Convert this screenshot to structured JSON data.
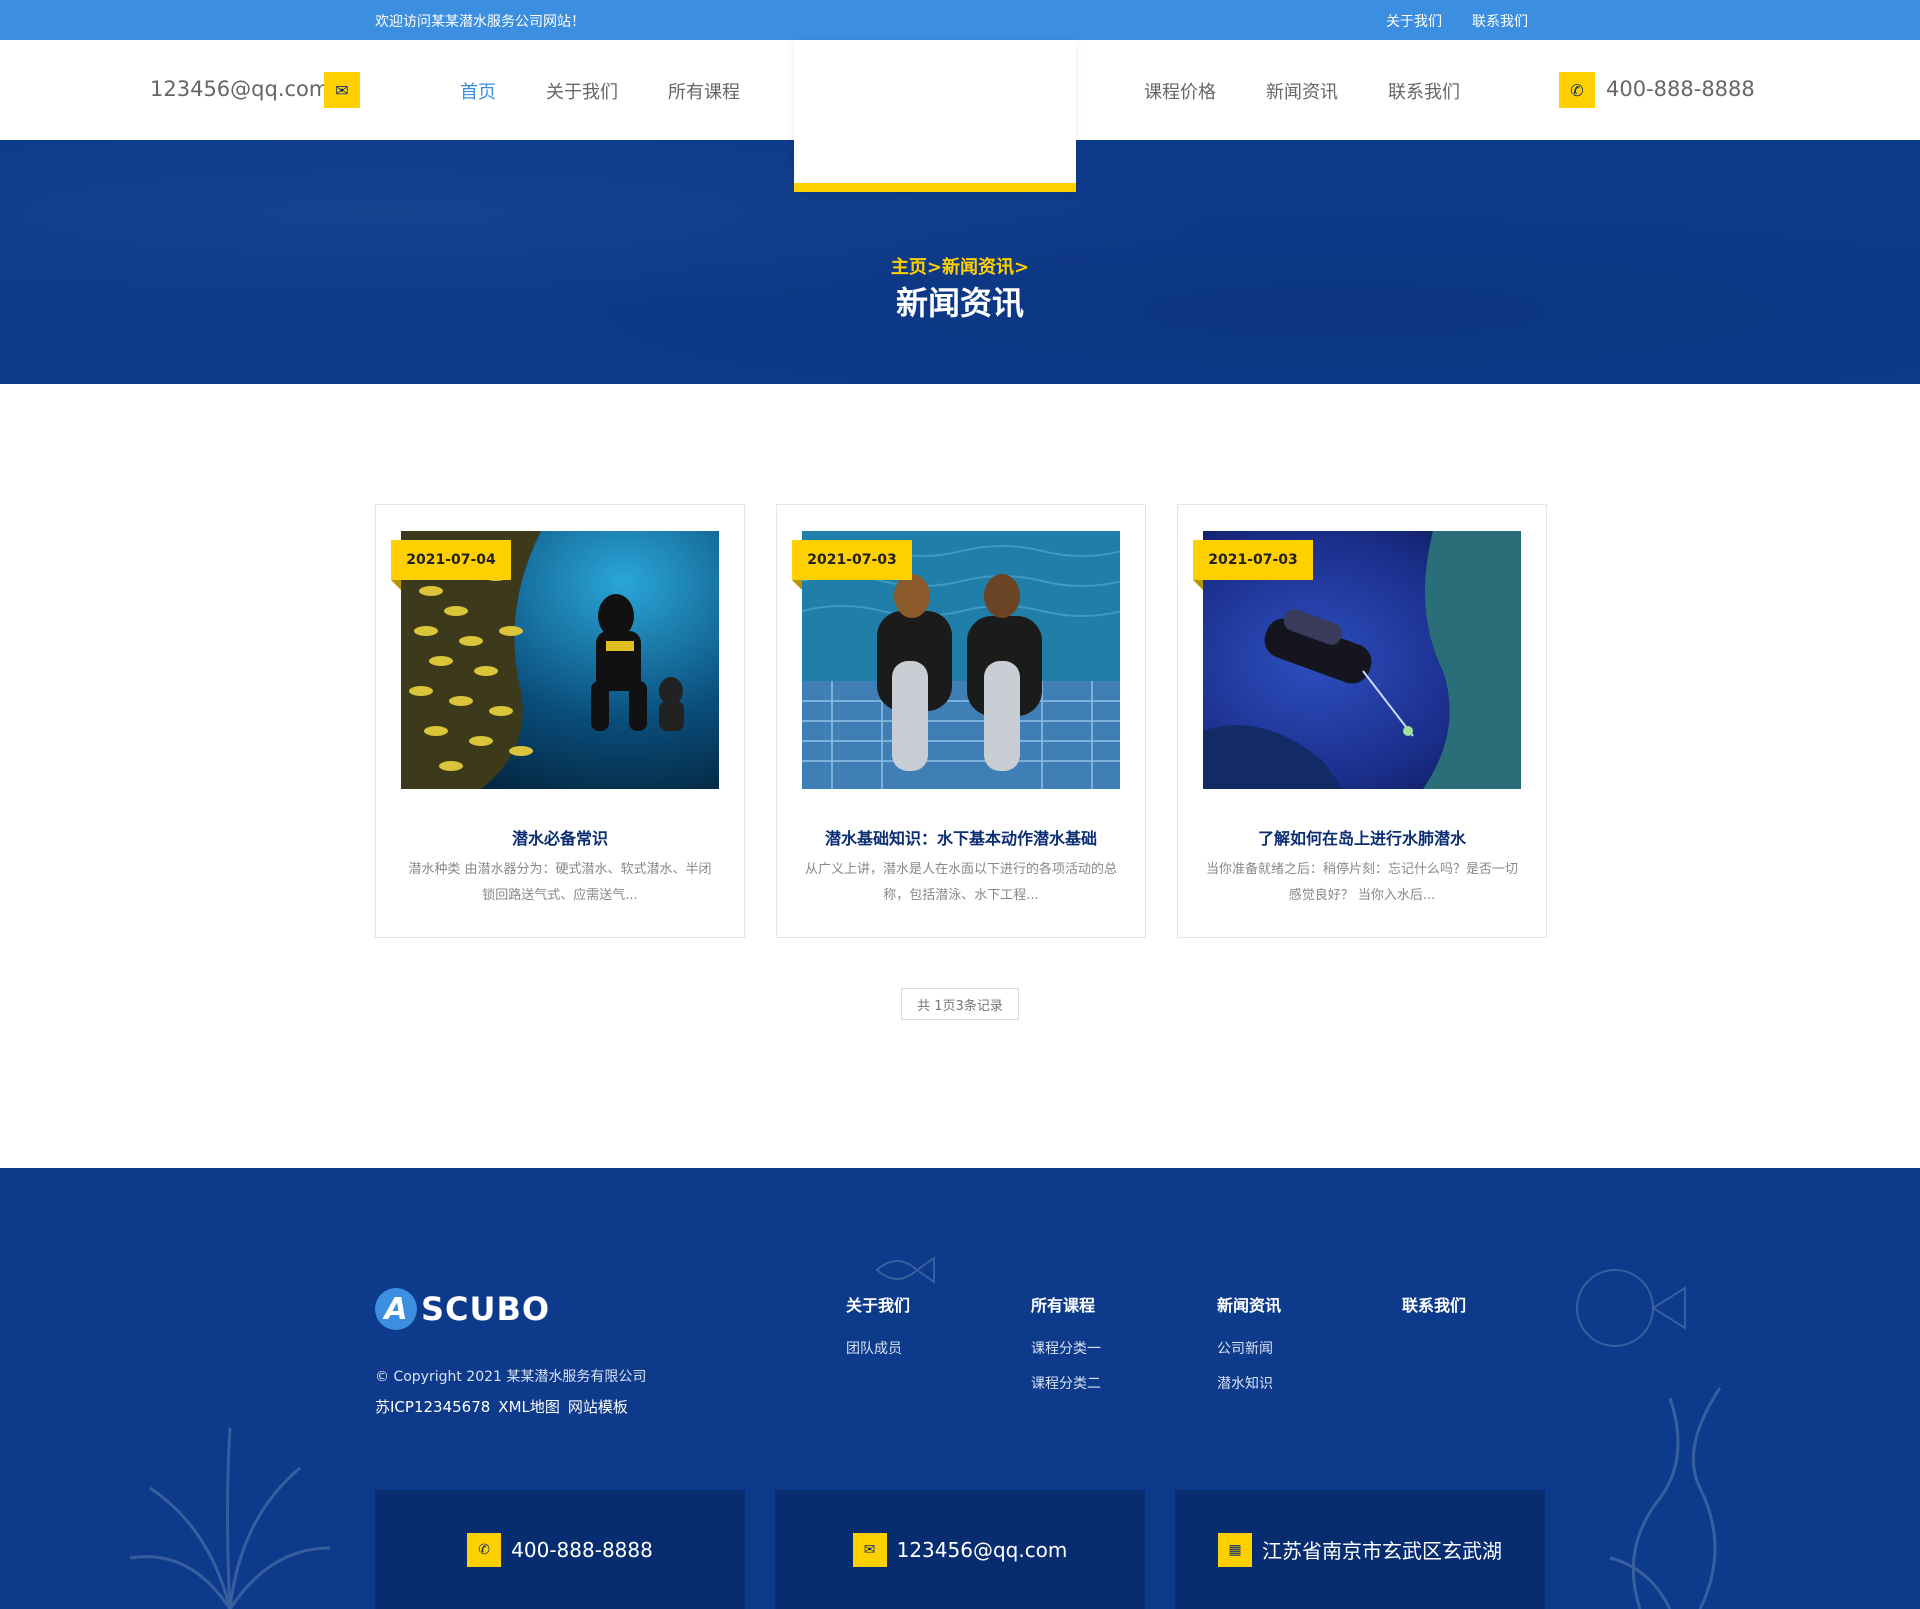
{
  "topbar": {
    "welcome": "欢迎访问某某潜水服务公司网站！",
    "links": [
      "关于我们",
      "联系我们"
    ]
  },
  "header": {
    "email": "123456@qq.com",
    "phone": "400-888-8888",
    "nav_left": [
      "首页",
      "关于我们",
      "所有课程"
    ],
    "nav_right": [
      "课程价格",
      "新闻资讯",
      "联系我们"
    ],
    "active": "首页"
  },
  "banner": {
    "breadcrumb": "主页>新闻资讯>",
    "title": "新闻资讯"
  },
  "news": [
    {
      "date": "2021-07-04",
      "title": "潜水必备常识",
      "desc": "潜水种类 由潜水器分为：硬式潜水、软式潜水、半闭锁回路送气式、应需送气..."
    },
    {
      "date": "2021-07-03",
      "title": "潜水基础知识：水下基本动作潜水基础",
      "desc": "从广义上讲，潜水是人在水面以下进行的各项活动的总称，包括潜泳、水下工程..."
    },
    {
      "date": "2021-07-03",
      "title": "了解如何在岛上进行水肺潜水",
      "desc": "当你准备就绪之后：稍停片刻：忘记什么吗？是否一切感觉良好？ 当你入水后..."
    }
  ],
  "pager": "共 1页3条记录",
  "footer": {
    "logo_letter": "A",
    "logo_text": "SCUBO",
    "copyright": "© Copyright 2021 某某潜水服务有限公司",
    "icp": "苏ICP12345678",
    "xml": "XML地图",
    "template": "网站模板",
    "columns": [
      {
        "head": "关于我们",
        "items": [
          "团队成员"
        ]
      },
      {
        "head": "所有课程",
        "items": [
          "课程分类一",
          "课程分类二"
        ]
      },
      {
        "head": "新闻资讯",
        "items": [
          "公司新闻",
          "潜水知识"
        ]
      },
      {
        "head": "联系我们",
        "items": []
      }
    ],
    "phone": "400-888-8888",
    "email": "123456@qq.com",
    "address": "江苏省南京市玄武区玄武湖"
  },
  "colors": {
    "topbar": "#3c8ee0",
    "navy": "#0d3a8a",
    "accent_yellow": "#ffd000",
    "active_nav": "#3c8ee0"
  },
  "icons": {
    "email": "envelope-icon",
    "phone": "phone-icon",
    "map": "map-icon"
  }
}
